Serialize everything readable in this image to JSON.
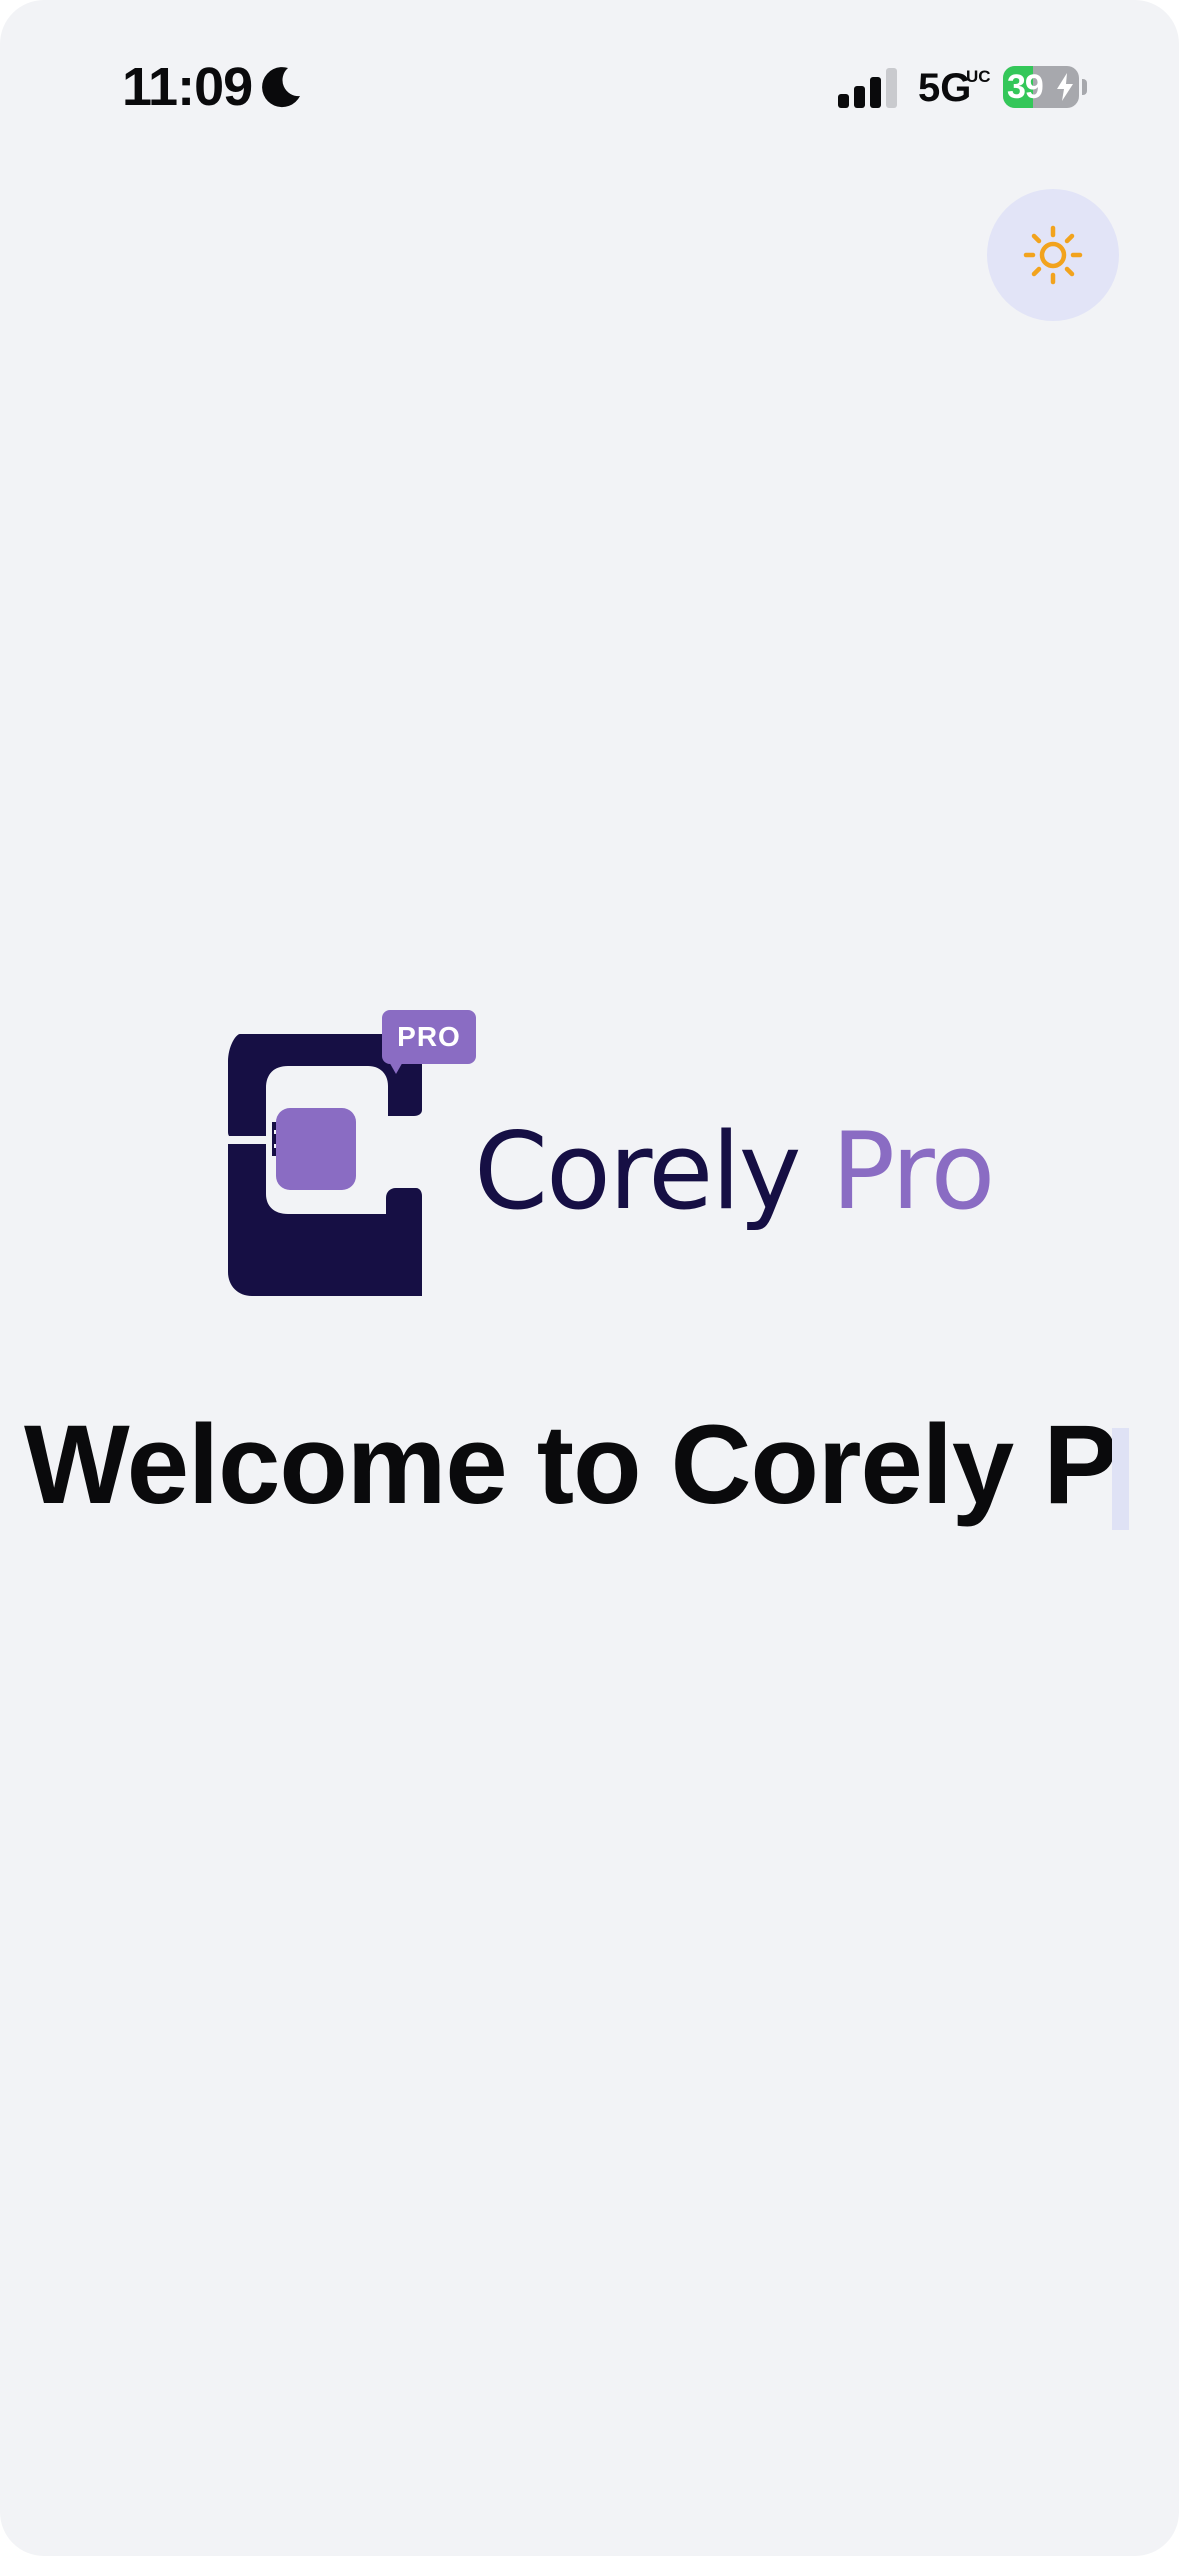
{
  "status_bar": {
    "time": "11:09",
    "focus_icon": "moon-icon",
    "signal_icon": "cellular-signal-icon",
    "signal_bars_active": 3,
    "network": "5G",
    "network_variant": "UC",
    "battery_percent": "39",
    "battery_level": 0.39,
    "charging_icon": "bolt-icon"
  },
  "header": {
    "theme_toggle_icon": "sun-icon"
  },
  "logo": {
    "badge": "PRO",
    "brand_primary": "Corely",
    "brand_accent": "Pro"
  },
  "main": {
    "heading": "Welcome to Corely P"
  },
  "colors": {
    "background": "#f2f3f6",
    "brand_navy": "#160f44",
    "brand_purple": "#8a6cc3",
    "sun": "#f2a31d",
    "toggle_bg": "#e2e4f7",
    "battery_green": "#34c759"
  }
}
